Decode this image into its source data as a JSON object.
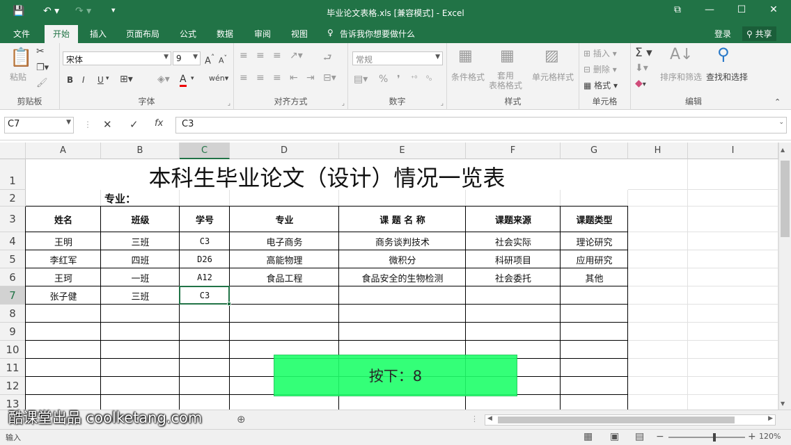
{
  "window": {
    "title": "毕业论文表格.xls  [兼容模式] - Excel",
    "controls": [
      "⧉",
      "—",
      "☐",
      "✕"
    ]
  },
  "tabs": [
    "文件",
    "开始",
    "插入",
    "页面布局",
    "公式",
    "数据",
    "审阅",
    "视图"
  ],
  "tell_me": "告诉我你想要做什么",
  "login": "登录",
  "share": "共享",
  "ribbon": {
    "clipboard": {
      "paste": "粘贴",
      "label": "剪贴板"
    },
    "font": {
      "name": "宋体",
      "size": "9",
      "label": "字体",
      "bold": "B",
      "italic": "I",
      "underline": "U"
    },
    "align": {
      "label": "对齐方式"
    },
    "number": {
      "format": "常规",
      "label": "数字"
    },
    "styles": {
      "cond": "条件格式",
      "table": "套用\n表格格式",
      "cell": "单元格样式",
      "label": "样式"
    },
    "cells": {
      "insert": "插入",
      "delete": "删除",
      "format": "格式",
      "label": "单元格"
    },
    "edit": {
      "sort": "排序和筛选",
      "find": "查找和选择",
      "label": "编辑"
    }
  },
  "formula_bar": {
    "name_box": "C7",
    "formula": "C3"
  },
  "columns": [
    "A",
    "B",
    "C",
    "D",
    "E",
    "F",
    "G",
    "H",
    "I"
  ],
  "rows": [
    "1",
    "2",
    "3",
    "4",
    "5",
    "6",
    "7",
    "8",
    "9",
    "10",
    "11",
    "12",
    "13"
  ],
  "sheet": {
    "title": "本科生毕业论文（设计）情况一览表",
    "major_label": "专业：",
    "headers": [
      "姓名",
      "班级",
      "学号",
      "专业",
      "课 题 名 称",
      "课题来源",
      "课题类型"
    ],
    "data": [
      [
        "王明",
        "三班",
        "C3",
        "电子商务",
        "商务谈判技术",
        "社会实际",
        "理论研究"
      ],
      [
        "李红军",
        "四班",
        "D26",
        "高能物理",
        "微积分",
        "科研项目",
        "应用研究"
      ],
      [
        "王珂",
        "一班",
        "A12",
        "食品工程",
        "食品安全的生物检测",
        "社会委托",
        "其他"
      ],
      [
        "张子健",
        "三班",
        "C3",
        "",
        "",
        "",
        ""
      ]
    ]
  },
  "popup": "按下：8",
  "watermark": "酷课堂出品 coolketang.com",
  "status": {
    "mode": "输入",
    "zoom": "120%"
  }
}
